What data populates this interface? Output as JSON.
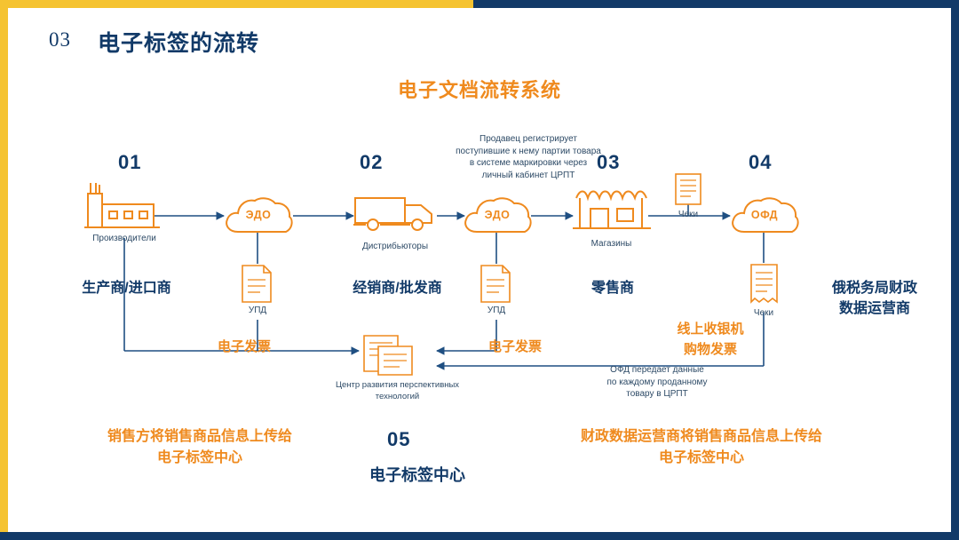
{
  "slide": {
    "number": "03",
    "title": "电子标签的流转",
    "main_title": "电子文档流转系统"
  },
  "colors": {
    "navy": "#123a68",
    "orange": "#ef8a1e",
    "yellow": "#f5c331",
    "line": "#1f4f82"
  },
  "steps": [
    {
      "num": "01",
      "ru_label": "Производители",
      "cn_label": "生产商/进口商"
    },
    {
      "num": "02",
      "ru_label": "Дистрибьюторы",
      "cn_label": "经销商/批发商"
    },
    {
      "num": "03",
      "ru_label": "Магазины",
      "cn_label": "零售商"
    },
    {
      "num": "04",
      "ru_label": "",
      "cn_label": "俄税务局财政\n数据运营商"
    },
    {
      "num": "05",
      "ru_label": "Центр развития перспективных технологий",
      "cn_label": "电子标签中心"
    }
  ],
  "clouds": [
    {
      "name": "edo-1",
      "label": "ЭДО"
    },
    {
      "name": "edo-2",
      "label": "ЭДО"
    },
    {
      "name": "ofd",
      "label": "ОФД"
    }
  ],
  "documents": [
    {
      "name": "upd-1",
      "label": "УПД"
    },
    {
      "name": "upd-2",
      "label": "УПД"
    },
    {
      "name": "cheki-top",
      "label": "Чеки"
    },
    {
      "name": "cheki-bottom",
      "label": "Чеки"
    }
  ],
  "annotations": {
    "top_note": "Продавец регистрирует\nпоступившие к нему партии товара\nв системе маркировки через\nличный кабинет ЦРПТ",
    "ofd_note": "ОФД передает данные\nпо каждому проданному\nтовару в ЦРПТ",
    "invoice_left": "电子发票",
    "invoice_mid": "电子发票",
    "pos_receipt": "线上收银机\n购物发票"
  },
  "bottom_captions": {
    "left": "销售方将销售商品信息上传给\n电子标签中心",
    "center_num": "05",
    "center": "电子标签中心",
    "right": "财政数据运营商将销售商品信息上传给\n电子标签中心"
  }
}
